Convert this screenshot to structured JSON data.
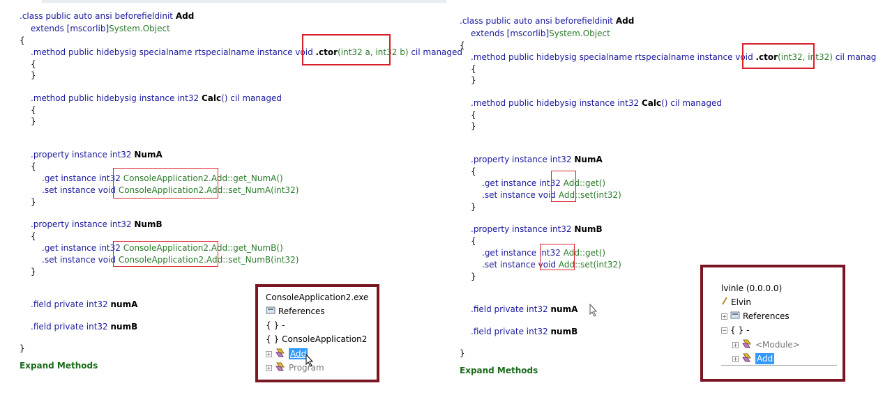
{
  "left": {
    "class_line": {
      "a": ".class public auto ansi beforefieldinit ",
      "b": "Add"
    },
    "extends_line": {
      "a": "extends ",
      "b": "[mscorlib]",
      "c": "System.Object"
    },
    "open": "{",
    "close": "}",
    "ctor_line": {
      "a": ".method public hidebysig specialname rtspecialname instance void ",
      "b": ".ctor",
      "c": "(int32 a, int32 b)",
      "d": " cil managed"
    },
    "calc_line": {
      "a": ".method public hidebysig instance int32 ",
      "b": "Calc",
      "c": "() cil managed"
    },
    "propA_line": {
      "a": ".property instance int32 ",
      "b": "NumA"
    },
    "getA": {
      "a": ".get instance int32 ",
      "b": "ConsoleApplication2.Add::get_NumA()"
    },
    "setA": {
      "a": ".set instance void ",
      "b": "ConsoleApplication2.Add::set_NumA(int32)"
    },
    "propB_line": {
      "a": ".property instance int32 ",
      "b": "NumB"
    },
    "getB": {
      "a": ".get instance int32 ",
      "b": "ConsoleApplication2.Add::get_NumB()"
    },
    "setB": {
      "a": ".set instance void ",
      "b": "ConsoleApplication2.Add::set_NumB(int32)"
    },
    "fieldA": {
      "a": ".field private int32 ",
      "b": "numA"
    },
    "fieldB": {
      "a": ".field private int32 ",
      "b": "numB"
    },
    "expand_methods": "Expand Methods",
    "tree": {
      "items": [
        "ConsoleApplication2.exe",
        "References",
        "-",
        "ConsoleApplication2",
        "Add",
        "Program"
      ],
      "brace": "{ }"
    }
  },
  "right": {
    "class_line": {
      "a": ".class public auto ansi beforefieldinit ",
      "b": "Add"
    },
    "extends_line": {
      "a": "extends ",
      "b": "[mscorlib]",
      "c": "System.Object"
    },
    "open": "{",
    "close": "}",
    "ctor_line": {
      "a": ".method public hidebysig specialname rtspecialname instance void ",
      "b": ".ctor",
      "c": "(int32, int32)",
      "d": " cil managed"
    },
    "calc_line": {
      "a": ".method public hidebysig instance int32 ",
      "b": "Calc",
      "c": "() cil managed"
    },
    "propA_line": {
      "a": ".property instance int32 ",
      "b": "NumA"
    },
    "getA": {
      "a": ".get instance int32 ",
      "b": "Add",
      "c": "::get()"
    },
    "setA": {
      "a": ".set instance void ",
      "b": "Add",
      "c": "::set(int32)"
    },
    "propB_line": {
      "a": ".property instance int32 ",
      "b": "NumB"
    },
    "getB": {
      "a": ".get instance int32 ",
      "b": "Add",
      "c": "::get()"
    },
    "setB": {
      "a": ".set instance void ",
      "b": "Add",
      "c": "::set(int32)"
    },
    "fieldA": {
      "a": ".field private int32 ",
      "b": "numA"
    },
    "fieldB": {
      "a": ".field private int32 ",
      "b": "numB"
    },
    "expand_methods": "Expand Methods",
    "tree": {
      "items": [
        "lvinle (0.0.0.0)",
        "Elvin",
        "References",
        "-",
        "<Module>",
        "Add"
      ],
      "brace": "{ }"
    }
  },
  "colors": {
    "highlight_border": "#d9202a",
    "tree_border": "#7a1624",
    "selection": "#3399ff"
  }
}
